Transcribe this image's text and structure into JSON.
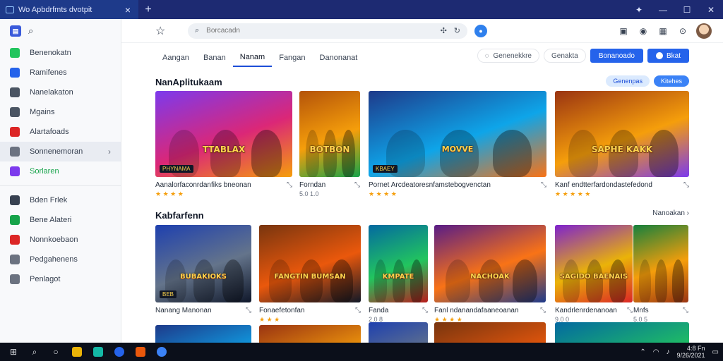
{
  "browser": {
    "tab_title": "Wo Apbdrfmts dvotpit",
    "new_tab": "+",
    "close_tab": "×"
  },
  "sidebar": {
    "items": [
      {
        "label": "Benenokatn",
        "color": "#22c55e",
        "green": false,
        "selected": false
      },
      {
        "label": "Ramifenes",
        "color": "#2563eb",
        "green": false,
        "selected": false
      },
      {
        "label": "Nanelakaton",
        "color": "#4b5563",
        "green": false,
        "selected": false
      },
      {
        "label": "Mgains",
        "color": "#4b5563",
        "green": false,
        "selected": false
      },
      {
        "label": "Alartafoads",
        "color": "#dc2626",
        "green": false,
        "selected": false
      },
      {
        "label": "Sonnenemoran",
        "color": "#6b7280",
        "green": false,
        "selected": true
      },
      {
        "label": "Sorlaren",
        "color": "#7c3aed",
        "green": true,
        "selected": false
      }
    ],
    "items2": [
      {
        "label": "Bden Frlek",
        "color": "#374151"
      },
      {
        "label": "Bene Alateri",
        "color": "#16a34a"
      },
      {
        "label": "Nonnkoebaon",
        "color": "#dc2626"
      },
      {
        "label": "Pedgahenens",
        "color": "#6b7280"
      },
      {
        "label": "Penlagot",
        "color": "#6b7280"
      }
    ]
  },
  "toolbar": {
    "search_placeholder": "Borcacadn"
  },
  "nav": {
    "tabs": [
      "Aangan",
      "Banan",
      "Nanam",
      "Fangan",
      "Danonanat"
    ],
    "active_index": 2,
    "pill1": "Genenekkre",
    "pill2": "Genakta",
    "btn1": "Bonanoado",
    "btn2": "Bkat"
  },
  "section1": {
    "title": "NanAplitukaam",
    "chip1": "Genenpas",
    "chip2": "Kitehes",
    "cards": [
      {
        "title": "Aanalorfaconrdanfiks bneonan",
        "meta": "",
        "rating": "★ ★ ★ ★",
        "label": "TTABLAX",
        "sticker": "PHYNAMA"
      },
      {
        "title": "Forndan",
        "meta": "5.0 1.0",
        "rating": "",
        "label": "BOTBON",
        "sticker": ""
      },
      {
        "title": "Pornet Arcdeatoresnfamstebogvenctan",
        "meta": "",
        "rating": "★ ★ ★ ★",
        "label": "MOVVE",
        "sticker": "KBAEY"
      },
      {
        "title": "Kanf endtterfardondastefedond",
        "meta": "",
        "rating": "★ ★ ★ ★ ★",
        "label": "SAPHE KAKK",
        "sticker": ""
      }
    ]
  },
  "section2": {
    "title": "Kabfarfenn",
    "more": "Nanoakan",
    "cards": [
      {
        "title": "Nanang Manonan",
        "meta": "",
        "rating": "",
        "label": "BUBAKIOKS",
        "sticker": "BEB"
      },
      {
        "title": "Fonaefetonfan",
        "meta": "",
        "rating": "★ ★ ★",
        "label": "FANGTIN BUMSAN",
        "sticker": ""
      },
      {
        "title": "Fanda",
        "meta": "2.0 8",
        "rating": "",
        "label": "KMPATE",
        "sticker": ""
      },
      {
        "title": "Fanl ndanandafaaneoanan",
        "meta": "",
        "rating": "★ ★ ★ ★",
        "label": "NACHOAK",
        "sticker": ""
      },
      {
        "title": "Kandrlenrdenanoan",
        "meta": "9.0 0",
        "rating": "",
        "label": "SAGIDO BAENAIS",
        "sticker": ""
      },
      {
        "title": "Mnfs",
        "meta": "5.0 5",
        "rating": "",
        "label": "",
        "sticker": ""
      }
    ]
  },
  "taskbar": {
    "time": "4:8 Fn",
    "date": "9/26/2021"
  }
}
